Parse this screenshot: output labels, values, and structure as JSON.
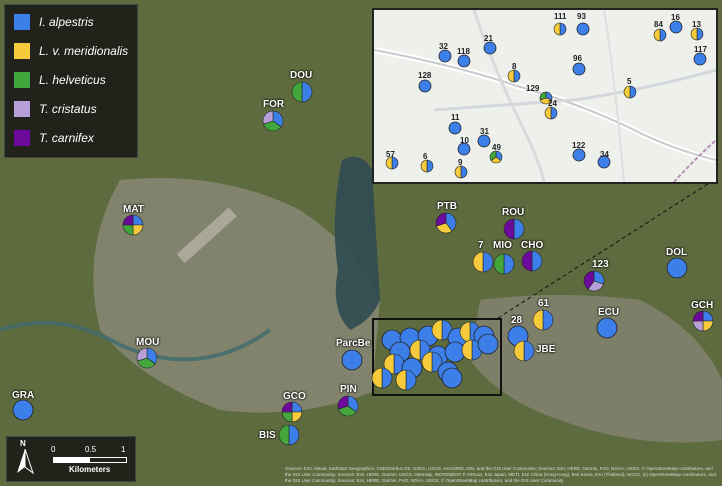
{
  "colors": {
    "alpestris": "#3d7fe8",
    "meridionalis": "#f5cb3c",
    "helveticus": "#43a63d",
    "cristatus": "#b7a0d8",
    "carnifex": "#6c0a9c"
  },
  "legend": [
    {
      "label": "I. alpestris",
      "color": "#3d7fe8"
    },
    {
      "label": "L. v. meridionalis",
      "color": "#f5cb3c"
    },
    {
      "label": "L. helveticus",
      "color": "#43a63d"
    },
    {
      "label": "T. cristatus",
      "color": "#b7a0d8"
    },
    {
      "label": "T. carnifex",
      "color": "#6c0a9c"
    }
  ],
  "sites": [
    {
      "name": "DOU",
      "fracs": {
        "alpestris": 0.5,
        "helveticus": 0.5
      }
    },
    {
      "name": "FOR",
      "fracs": {
        "alpestris": 0.35,
        "helveticus": 0.35,
        "cristatus": 0.3
      }
    },
    {
      "name": "MAT",
      "fracs": {
        "alpestris": 0.25,
        "meridionalis": 0.25,
        "helveticus": 0.25,
        "carnifex": 0.25
      }
    },
    {
      "name": "PTB",
      "fracs": {
        "alpestris": 0.4,
        "meridionalis": 0.3,
        "carnifex": 0.3
      }
    },
    {
      "name": "ROU",
      "fracs": {
        "alpestris": 0.5,
        "carnifex": 0.5
      }
    },
    {
      "name": "7",
      "fracs": {
        "alpestris": 0.5,
        "meridionalis": 0.5
      }
    },
    {
      "name": "MIO",
      "fracs": {
        "alpestris": 0.5,
        "helveticus": 0.5
      }
    },
    {
      "name": "CHO",
      "fracs": {
        "alpestris": 0.5,
        "carnifex": 0.5
      }
    },
    {
      "name": "123",
      "fracs": {
        "alpestris": 0.3,
        "cristatus": 0.3,
        "carnifex": 0.4
      }
    },
    {
      "name": "DOL",
      "fracs": {
        "alpestris": 1
      }
    },
    {
      "name": "61",
      "fracs": {
        "alpestris": 0.5,
        "meridionalis": 0.5
      }
    },
    {
      "name": "ECU",
      "fracs": {
        "alpestris": 1
      }
    },
    {
      "name": "GCH",
      "fracs": {
        "alpestris": 0.25,
        "meridionalis": 0.25,
        "cristatus": 0.25,
        "carnifex": 0.25
      }
    },
    {
      "name": "28",
      "fracs": {
        "alpestris": 1
      }
    },
    {
      "name": "JBE",
      "fracs": {
        "alpestris": 0.5,
        "meridionalis": 0.5
      }
    },
    {
      "name": "MOU",
      "fracs": {
        "alpestris": 0.35,
        "helveticus": 0.35,
        "cristatus": 0.3
      }
    },
    {
      "name": "ParcBe",
      "fracs": {
        "alpestris": 1
      }
    },
    {
      "name": "PIN",
      "fracs": {
        "alpestris": 0.35,
        "helveticus": 0.35,
        "carnifex": 0.3
      }
    },
    {
      "name": "GCO",
      "fracs": {
        "alpestris": 0.25,
        "meridionalis": 0.25,
        "helveticus": 0.25,
        "carnifex": 0.25
      }
    },
    {
      "name": "BIS",
      "fracs": {
        "alpestris": 0.5,
        "helveticus": 0.5
      }
    },
    {
      "name": "GRA",
      "fracs": {
        "alpestris": 1
      }
    }
  ],
  "inset_sites": [
    {
      "name": "111",
      "fracs": {
        "alpestris": 0.5,
        "meridionalis": 0.5
      }
    },
    {
      "name": "93",
      "fracs": {
        "alpestris": 1
      }
    },
    {
      "name": "16",
      "fracs": {
        "alpestris": 1
      }
    },
    {
      "name": "84",
      "fracs": {
        "alpestris": 0.5,
        "meridionalis": 0.5
      }
    },
    {
      "name": "13",
      "fracs": {
        "alpestris": 0.5,
        "meridionalis": 0.5
      }
    },
    {
      "name": "21",
      "fracs": {
        "alpestris": 1
      }
    },
    {
      "name": "32",
      "fracs": {
        "alpestris": 1
      }
    },
    {
      "name": "118",
      "fracs": {
        "alpestris": 1
      }
    },
    {
      "name": "117",
      "fracs": {
        "alpestris": 1
      }
    },
    {
      "name": "96",
      "fracs": {
        "alpestris": 1
      }
    },
    {
      "name": "8",
      "fracs": {
        "alpestris": 0.5,
        "meridionalis": 0.5
      }
    },
    {
      "name": "128",
      "fracs": {
        "alpestris": 1
      }
    },
    {
      "name": "5",
      "fracs": {
        "alpestris": 0.5,
        "meridionalis": 0.5
      }
    },
    {
      "name": "129",
      "fracs": {
        "alpestris": 0.3,
        "meridionalis": 0.4,
        "helveticus": 0.3
      }
    },
    {
      "name": "24",
      "fracs": {
        "alpestris": 0.5,
        "meridionalis": 0.5
      }
    },
    {
      "name": "11",
      "fracs": {
        "alpestris": 1
      }
    },
    {
      "name": "31",
      "fracs": {
        "alpestris": 1
      }
    },
    {
      "name": "10",
      "fracs": {
        "alpestris": 1
      }
    },
    {
      "name": "49",
      "fracs": {
        "alpestris": 0.35,
        "meridionalis": 0.3,
        "helveticus": 0.35
      }
    },
    {
      "name": "122",
      "fracs": {
        "alpestris": 1
      }
    },
    {
      "name": "34",
      "fracs": {
        "alpestris": 1
      }
    },
    {
      "name": "57",
      "fracs": {
        "alpestris": 0.5,
        "meridionalis": 0.5
      }
    },
    {
      "name": "6",
      "fracs": {
        "alpestris": 0.5,
        "meridionalis": 0.5
      }
    },
    {
      "name": "9",
      "fracs": {
        "alpestris": 0.5,
        "meridionalis": 0.5
      }
    }
  ],
  "zoom_cluster": [
    {
      "fracs": {
        "alpestris": 1
      }
    },
    {
      "fracs": {
        "alpestris": 1
      }
    },
    {
      "fracs": {
        "alpestris": 1
      }
    },
    {
      "fracs": {
        "alpestris": 0.5,
        "meridionalis": 0.5
      }
    },
    {
      "fracs": {
        "alpestris": 1
      }
    },
    {
      "fracs": {
        "alpestris": 0.5,
        "meridionalis": 0.5
      }
    },
    {
      "fracs": {
        "alpestris": 1
      }
    },
    {
      "fracs": {
        "alpestris": 1
      }
    },
    {
      "fracs": {
        "alpestris": 0.5,
        "meridionalis": 0.5
      }
    },
    {
      "fracs": {
        "alpestris": 1
      }
    },
    {
      "fracs": {
        "alpestris": 1
      }
    },
    {
      "fracs": {
        "alpestris": 0.5,
        "meridionalis": 0.5
      }
    },
    {
      "fracs": {
        "alpestris": 1
      }
    },
    {
      "fracs": {
        "alpestris": 0.5,
        "meridionalis": 0.5
      }
    },
    {
      "fracs": {
        "alpestris": 1
      }
    },
    {
      "fracs": {
        "alpestris": 0.5,
        "meridionalis": 0.5
      }
    },
    {
      "fracs": {
        "alpestris": 1
      }
    },
    {
      "fracs": {
        "alpestris": 0.5,
        "meridionalis": 0.5
      }
    },
    {
      "fracs": {
        "alpestris": 0.5,
        "meridionalis": 0.5
      }
    },
    {
      "fracs": {
        "alpestris": 1
      }
    }
  ],
  "scalebar": {
    "north": "N",
    "ticks": [
      "0",
      "0.5",
      "1"
    ],
    "unit": "Kilometers"
  },
  "attribution": "Sources: Esri, Maxar, Earthstar Geographics, CNES/Airbus DS, USDA, USGS, AeroGRID, IGN, and the GIS User Community; Sources: Esri, HERE, Garmin, FAO, NOAA, USGS, © OpenStreetMap contributors, and the GIS User Community; Sources: Esri, HERE, Garmin, USGS, Intermap, INCREMENT P, NRCan, Esri Japan, METI, Esri China (Hong Kong), Esri Korea, Esri (Thailand), NGCC, (c) OpenStreetMap contributors, and the GIS User Community; Sources: Esri, HERE, Garmin, FAO, NOAA, USGS, © OpenStreetMap contributors, and the GIS User Community"
}
